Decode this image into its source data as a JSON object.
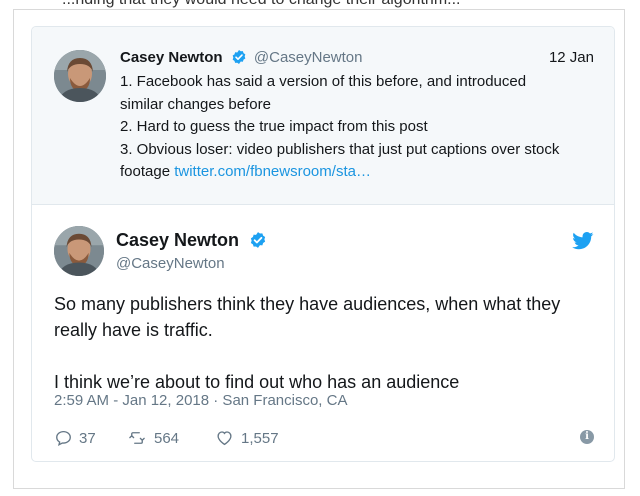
{
  "page": {
    "top_text": "...nding that they would need to change their algorithm..."
  },
  "quoted_tweet": {
    "name": "Casey Newton",
    "handle": "@CaseyNewton",
    "date": "12 Jan",
    "lines": [
      "1. Facebook has said a version of this before, and introduced",
      "similar changes before",
      "2. Hard to guess the true impact from this post",
      "3. Obvious loser: video publishers that just put captions over stock"
    ],
    "last_line_prefix": "footage ",
    "link_text": "twitter.com/fbnewsroom/sta…"
  },
  "tweet": {
    "name": "Casey Newton",
    "handle": "@CaseyNewton",
    "lines": [
      "So many publishers think they have audiences, when what they",
      "really have is traffic."
    ],
    "second_paragraph": "I think we’re about to find out who has an audience",
    "meta": "2:59 AM - Jan 12, 2018 · San Francisco, CA",
    "replies": "37",
    "retweets": "564",
    "likes": "1,557"
  },
  "icons": {
    "verified": "verified-badge-icon",
    "twitter": "twitter-bird-icon",
    "reply": "reply-icon",
    "retweet": "retweet-icon",
    "like": "heart-icon",
    "info": "info-icon"
  },
  "colors": {
    "link": "#1b95e0",
    "muted": "#657786",
    "quoted_bg": "#f5f8fa",
    "verified": "#1da1f2"
  }
}
